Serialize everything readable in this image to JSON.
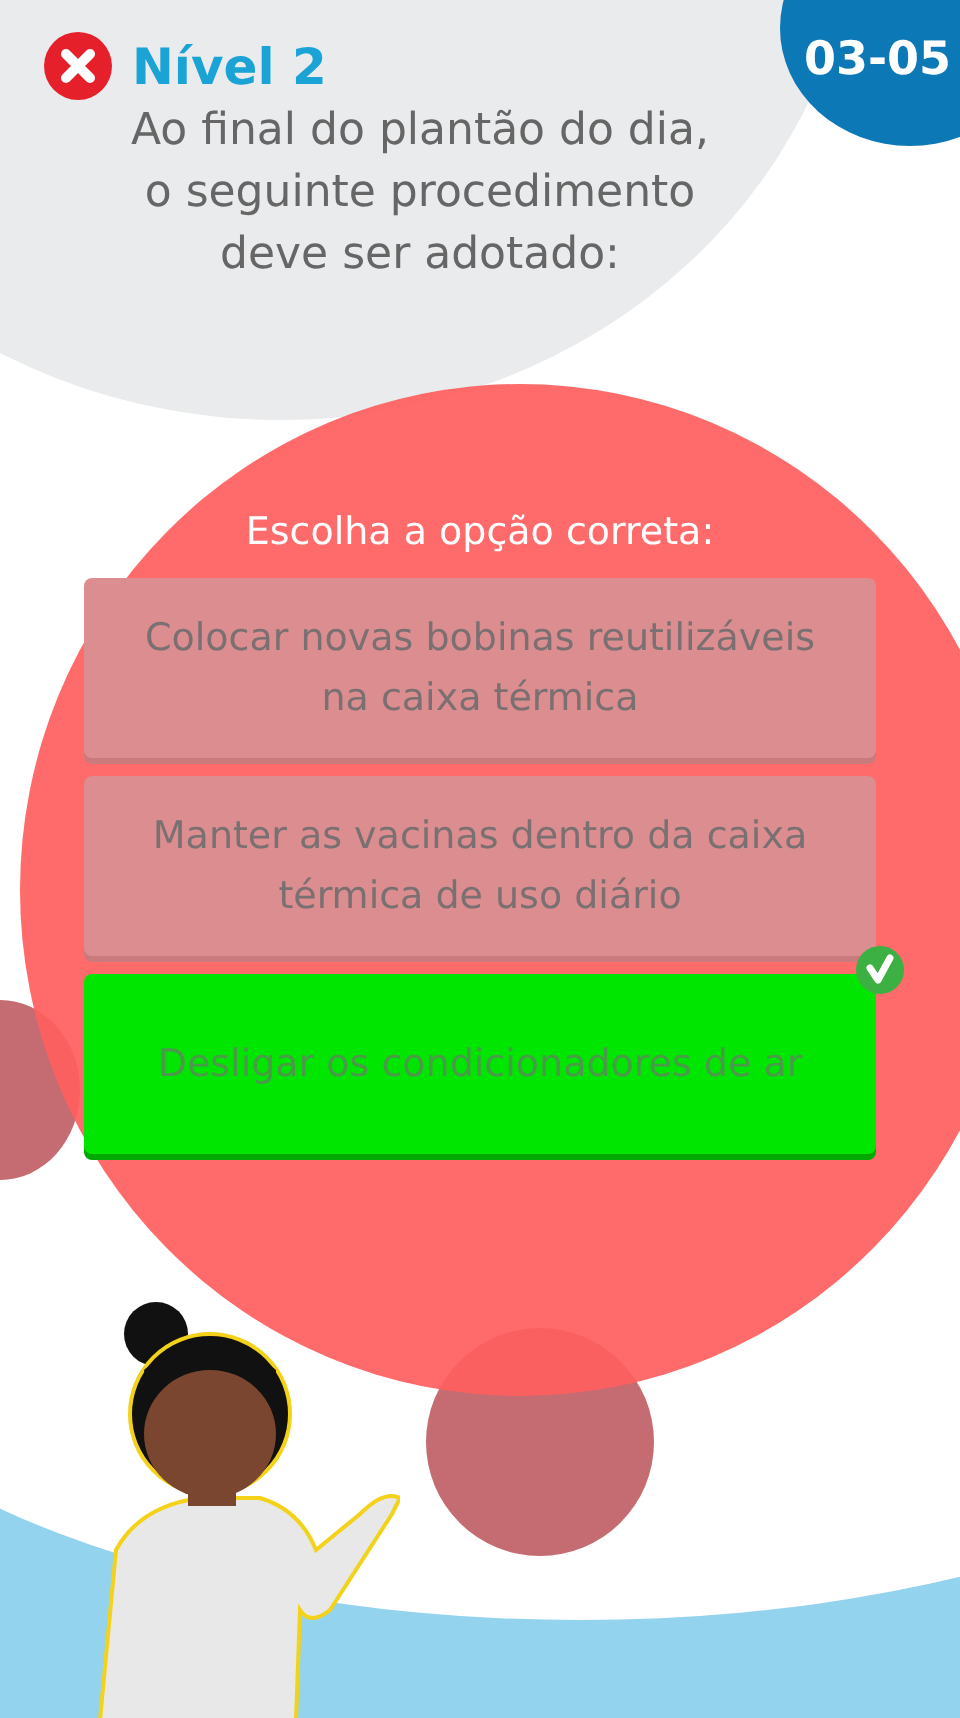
{
  "header": {
    "level": "Nível 2",
    "counter": "03-05"
  },
  "question": "Ao final do plantão do dia,\no seguinte procedimento\ndeve ser adotado:",
  "prompt": "Escolha a opção correta:",
  "options": [
    {
      "text": "Colocar novas bobinas reutilizáveis na caixa térmica",
      "correct": false
    },
    {
      "text": "Manter as vacinas dentro da caixa térmica de uso diário",
      "correct": false
    },
    {
      "text": "Desligar os condicionadores de ar",
      "correct": true
    }
  ]
}
